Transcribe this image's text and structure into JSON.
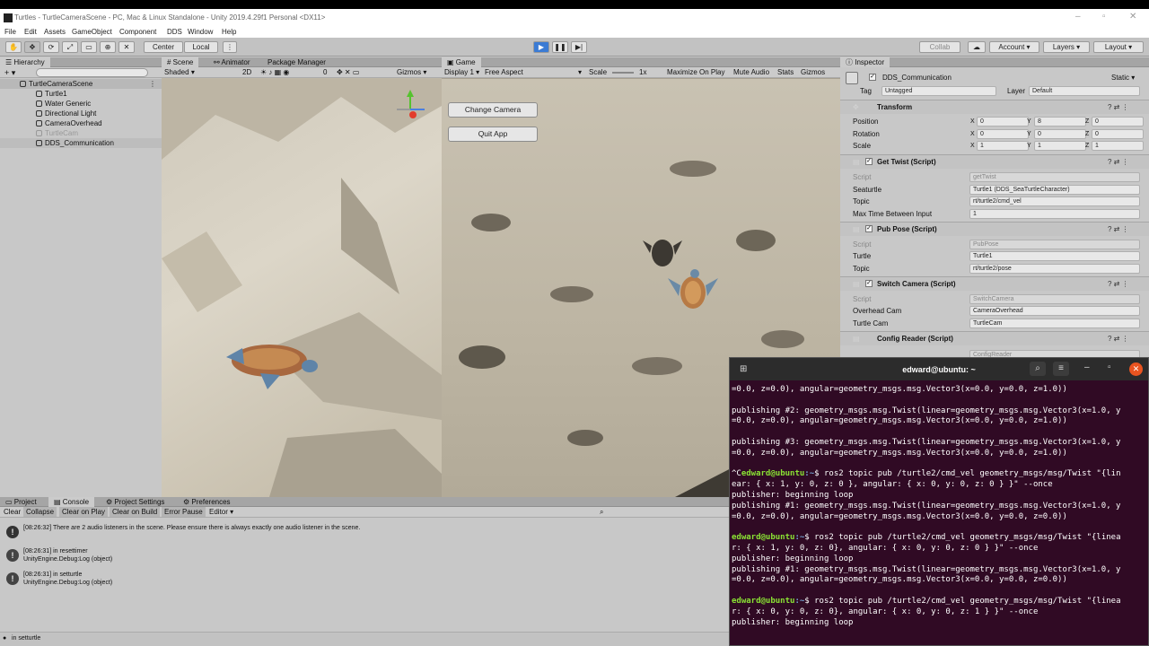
{
  "titlebar": {
    "title": "Turtles - TurtleCameraScene - PC, Mac & Linux Standalone - Unity 2019.4.29f1 Personal <DX11>"
  },
  "menu": [
    "File",
    "Edit",
    "Assets",
    "GameObject",
    "Component",
    "DDS",
    "Window",
    "Help"
  ],
  "toolbar": {
    "center": "Center",
    "local": "Local",
    "collab": "Collab",
    "account": "Account",
    "layers": "Layers",
    "layout": "Layout"
  },
  "hierarchy": {
    "tab": "Hierarchy",
    "scene": "TurtleCameraScene",
    "items": [
      "Turtle1",
      "Water Generic",
      "Directional Light",
      "CameraOverhead",
      "TurtleCam",
      "DDS_Communication"
    ]
  },
  "scene": {
    "tabs": [
      "Scene",
      "Animator",
      "Package Manager"
    ],
    "shading": "Shaded",
    "mode2d": "2D",
    "gizmos": "Gizmos",
    "fx_count": "0"
  },
  "game": {
    "tab": "Game",
    "display": "Display 1",
    "aspect": "Free Aspect",
    "scale_label": "Scale",
    "scale_value": "1x",
    "options": [
      "Maximize On Play",
      "Mute Audio",
      "Stats",
      "Gizmos"
    ],
    "buttons": [
      "Change Camera",
      "Quit App"
    ]
  },
  "inspector": {
    "tab": "Inspector",
    "object_name": "DDS_Communication",
    "static": "Static",
    "tag_label": "Tag",
    "tag_value": "Untagged",
    "layer_label": "Layer",
    "layer_value": "Default",
    "transform": {
      "title": "Transform",
      "position": {
        "label": "Position",
        "x": "0",
        "y": "8",
        "z": "0"
      },
      "rotation": {
        "label": "Rotation",
        "x": "0",
        "y": "0",
        "z": "0"
      },
      "scale": {
        "label": "Scale",
        "x": "1",
        "y": "1",
        "z": "1"
      }
    },
    "get_twist": {
      "title": "Get Twist (Script)",
      "script_label": "Script",
      "script_value": "getTwist",
      "seaturtle_label": "Seaturtle",
      "seaturtle_value": "Turtle1 (DDS_SeaTurtleCharacter)",
      "topic_label": "Topic",
      "topic_value": "rt/turtle2/cmd_vel",
      "maxtime_label": "Max Time Between Input",
      "maxtime_value": "1"
    },
    "pub_pose": {
      "title": "Pub Pose (Script)",
      "script_label": "Script",
      "script_value": "PubPose",
      "turtle_label": "Turtle",
      "turtle_value": "Turtle1",
      "topic_label": "Topic",
      "topic_value": "rt/turtle2/pose"
    },
    "switch_camera": {
      "title": "Switch Camera (Script)",
      "script_label": "Script",
      "script_value": "SwitchCamera",
      "overhead_label": "Overhead Cam",
      "overhead_value": "CameraOverhead",
      "turtlecam_label": "Turtle Cam",
      "turtlecam_value": "TurtleCam"
    },
    "config_reader": {
      "title": "Config Reader (Script)",
      "script_value": "ConfigReader"
    }
  },
  "console": {
    "tabs": [
      "Project",
      "Console",
      "Project Settings",
      "Preferences"
    ],
    "buttons": [
      "Clear",
      "Collapse",
      "Clear on Play",
      "Clear on Build",
      "Error Pause",
      "Editor"
    ],
    "logs": [
      {
        "line1": "[08:26:32] There are 2 audio listeners in the scene. Please ensure there is always exactly one audio listener in the scene.",
        "line2": ""
      },
      {
        "line1": "[08:26:31] in resettimer",
        "line2": "UnityEngine.Debug:Log (object)"
      },
      {
        "line1": "[08:26:31] in setturtle",
        "line2": "UnityEngine.Debug:Log (object)"
      }
    ],
    "status": "in setturtle"
  },
  "terminal": {
    "title": "edward@ubuntu: ~",
    "lines": [
      {
        "t": "plain",
        "text": "=0.0, z=0.0), angular=geometry_msgs.msg.Vector3(x=0.0, y=0.0, z=1.0))"
      },
      {
        "t": "plain",
        "text": ""
      },
      {
        "t": "plain",
        "text": "publishing #2: geometry_msgs.msg.Twist(linear=geometry_msgs.msg.Vector3(x=1.0, y"
      },
      {
        "t": "plain",
        "text": "=0.0, z=0.0), angular=geometry_msgs.msg.Vector3(x=0.0, y=0.0, z=1.0))"
      },
      {
        "t": "plain",
        "text": ""
      },
      {
        "t": "plain",
        "text": "publishing #3: geometry_msgs.msg.Twist(linear=geometry_msgs.msg.Vector3(x=1.0, y"
      },
      {
        "t": "plain",
        "text": "=0.0, z=0.0), angular=geometry_msgs.msg.Vector3(x=0.0, y=0.0, z=1.0))"
      },
      {
        "t": "plain",
        "text": ""
      },
      {
        "t": "prompt",
        "prefix": "^C",
        "user": "edward@ubuntu",
        "path": ":~",
        "cmd": "$ ros2 topic pub /turtle2/cmd_vel geometry_msgs/msg/Twist \"{lin"
      },
      {
        "t": "plain",
        "text": "ear: { x: 1, y: 0, z: 0 }, angular: { x: 0, y: 0, z: 0 } }\" --once"
      },
      {
        "t": "plain",
        "text": "publisher: beginning loop"
      },
      {
        "t": "plain",
        "text": "publishing #1: geometry_msgs.msg.Twist(linear=geometry_msgs.msg.Vector3(x=1.0, y"
      },
      {
        "t": "plain",
        "text": "=0.0, z=0.0), angular=geometry_msgs.msg.Vector3(x=0.0, y=0.0, z=0.0))"
      },
      {
        "t": "plain",
        "text": ""
      },
      {
        "t": "prompt",
        "prefix": "",
        "user": "edward@ubuntu",
        "path": ":~",
        "cmd": "$ ros2 topic pub /turtle2/cmd_vel geometry_msgs/msg/Twist \"{linea"
      },
      {
        "t": "plain",
        "text": "r: { x: 1, y: 0, z: 0}, angular: { x: 0, y: 0, z: 0 } }\" --once"
      },
      {
        "t": "plain",
        "text": "publisher: beginning loop"
      },
      {
        "t": "plain",
        "text": "publishing #1: geometry_msgs.msg.Twist(linear=geometry_msgs.msg.Vector3(x=1.0, y"
      },
      {
        "t": "plain",
        "text": "=0.0, z=0.0), angular=geometry_msgs.msg.Vector3(x=0.0, y=0.0, z=0.0))"
      },
      {
        "t": "plain",
        "text": ""
      },
      {
        "t": "prompt",
        "prefix": "",
        "user": "edward@ubuntu",
        "path": ":~",
        "cmd": "$ ros2 topic pub /turtle2/cmd_vel geometry_msgs/msg/Twist \"{linea"
      },
      {
        "t": "plain",
        "text": "r: { x: 0, y: 0, z: 0}, angular: { x: 0, y: 0, z: 1 } }\" --once"
      },
      {
        "t": "plain",
        "text": "publisher: beginning loop"
      }
    ]
  },
  "colors": {
    "terminal_bg": "#300a24",
    "prompt_green": "#8ae234",
    "prompt_blue": "#729fcf",
    "play_active": "#3b7bd4",
    "close_red": "#e95420"
  }
}
